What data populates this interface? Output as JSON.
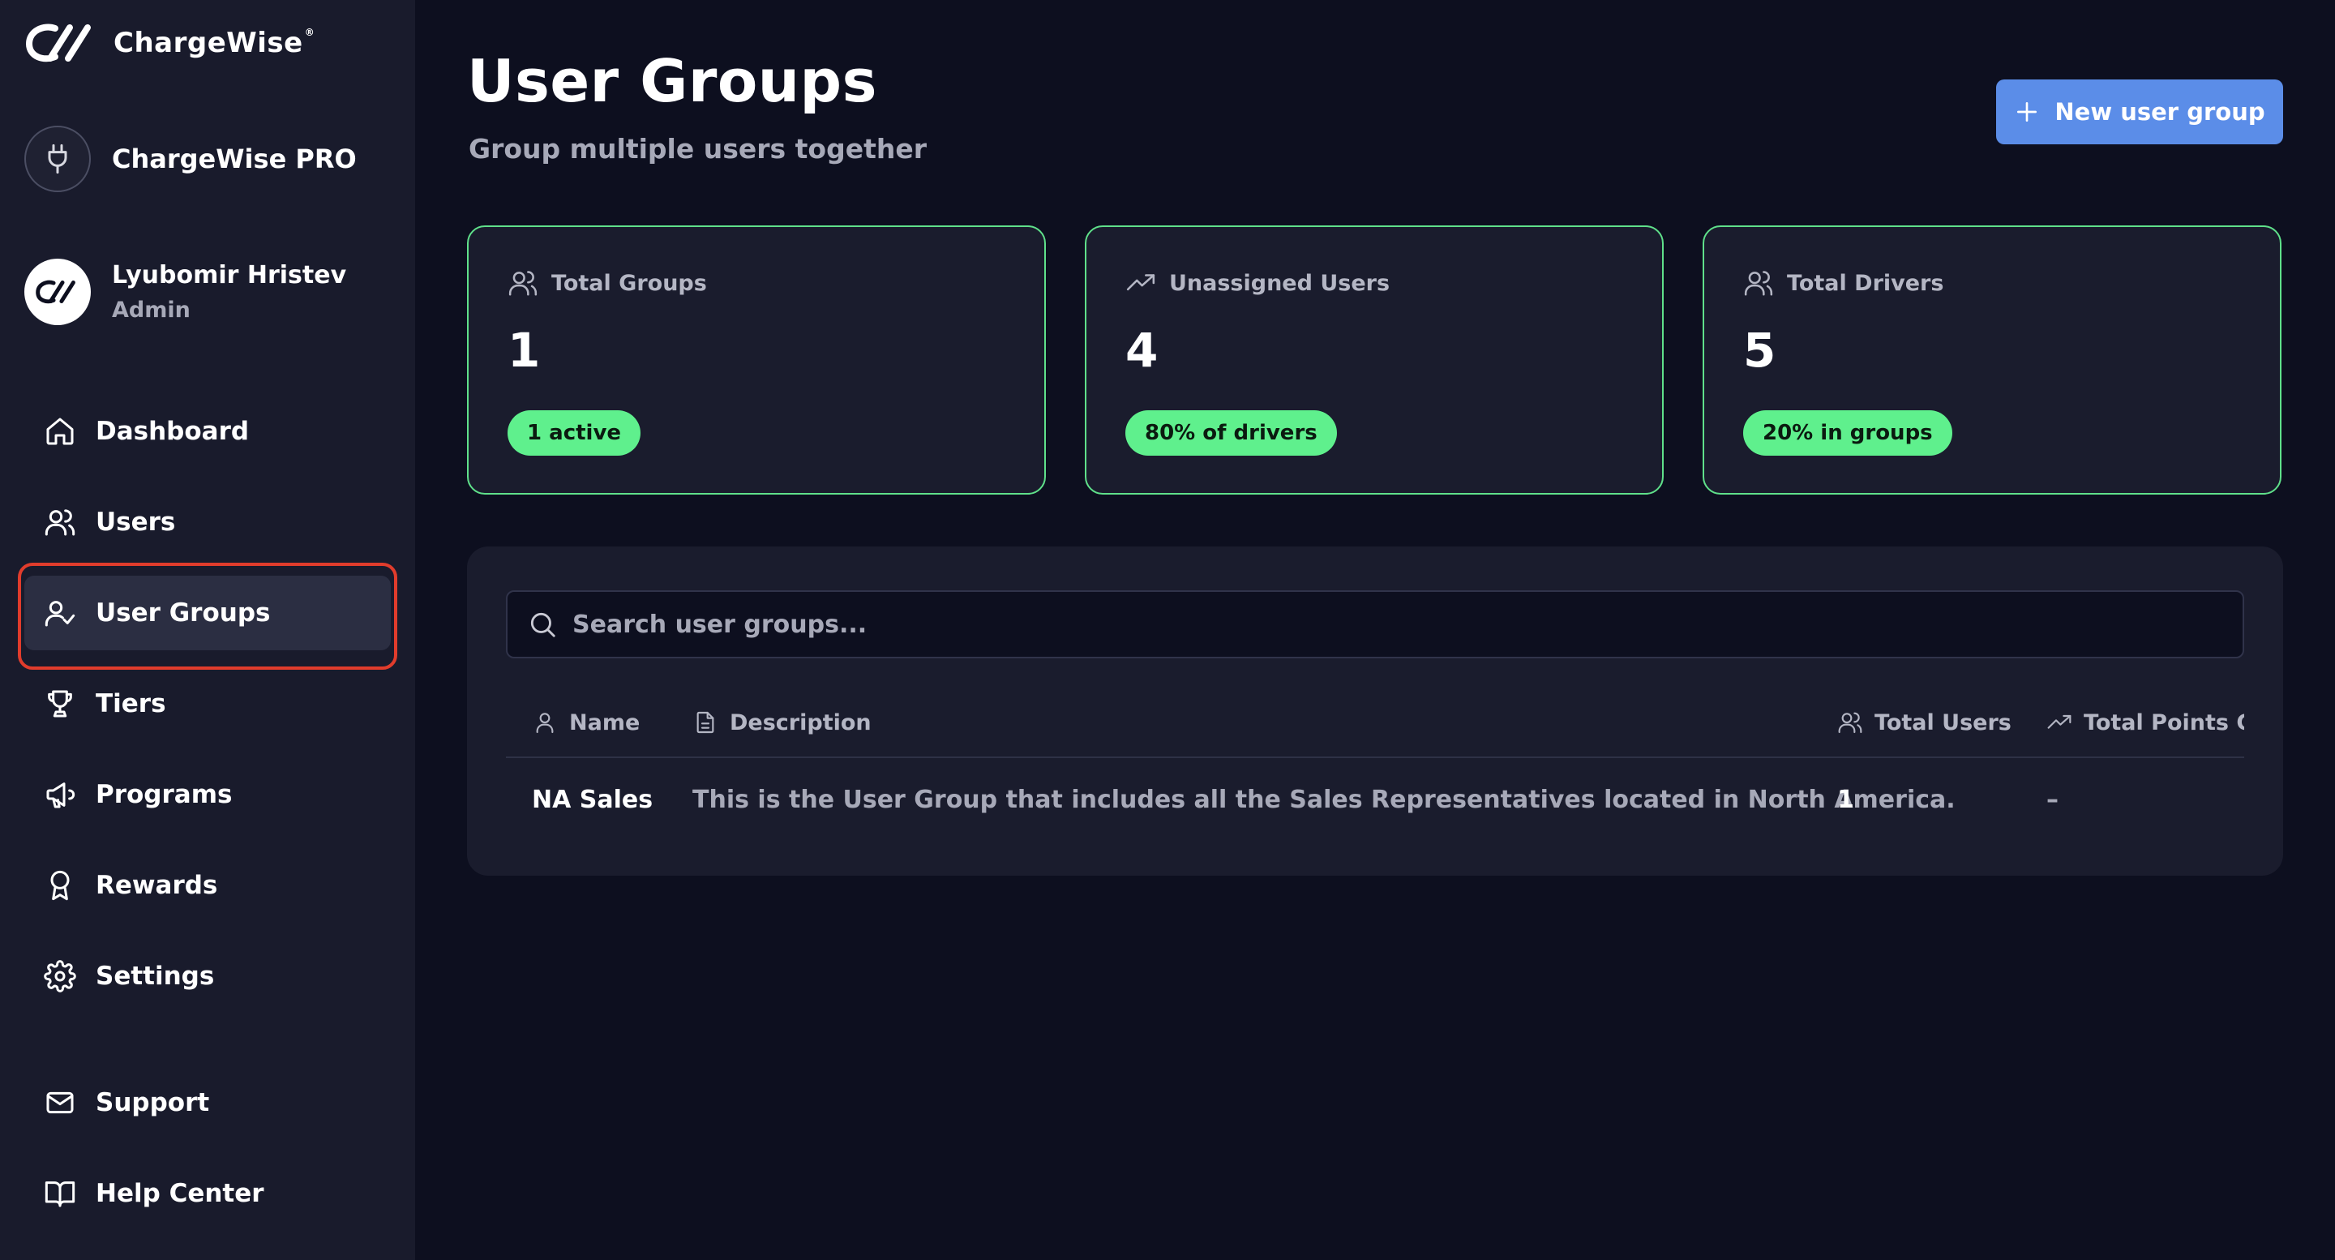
{
  "brand": {
    "name": "ChargeWise",
    "trademark": "®"
  },
  "organization": {
    "name": "ChargeWise PRO"
  },
  "user": {
    "name": "Lyubomir Hristev",
    "role": "Admin"
  },
  "sidebar": {
    "items": [
      {
        "label": "Dashboard",
        "icon": "home-icon"
      },
      {
        "label": "Users",
        "icon": "users-icon"
      },
      {
        "label": "User Groups",
        "icon": "user-check-icon",
        "active": true
      },
      {
        "label": "Tiers",
        "icon": "trophy-icon"
      },
      {
        "label": "Programs",
        "icon": "megaphone-icon"
      },
      {
        "label": "Rewards",
        "icon": "award-icon"
      },
      {
        "label": "Settings",
        "icon": "gear-icon"
      },
      {
        "label": "Support",
        "icon": "mail-icon"
      },
      {
        "label": "Help Center",
        "icon": "book-icon"
      }
    ]
  },
  "header": {
    "title": "User Groups",
    "subtitle": "Group multiple users together",
    "new_button_label": "New user group"
  },
  "stats": [
    {
      "label": "Total Groups",
      "value": "1",
      "badge": "1 active",
      "icon": "users-icon"
    },
    {
      "label": "Unassigned Users",
      "value": "4",
      "badge": "80% of drivers",
      "icon": "trending-up-icon"
    },
    {
      "label": "Total Drivers",
      "value": "5",
      "badge": "20% in groups",
      "icon": "users-icon"
    }
  ],
  "search": {
    "placeholder": "Search user groups...",
    "value": ""
  },
  "table": {
    "columns": [
      {
        "label": "Name",
        "icon": "user-icon"
      },
      {
        "label": "Description",
        "icon": "document-icon"
      },
      {
        "label": "Total Users",
        "icon": "users-icon"
      },
      {
        "label": "Total Points Ga",
        "icon": "trending-up-icon"
      }
    ],
    "rows": [
      {
        "name": "NA Sales",
        "description": "This is the User Group that includes all the Sales Representatives located in North America.",
        "total_users": "1",
        "total_points": "–"
      }
    ]
  },
  "colors": {
    "background": "#0d0f1f",
    "sidebar": "#191b2c",
    "card": "#1a1c2d",
    "accent_green": "#5ff08d",
    "primary_button": "#5b8de8",
    "highlight_outline": "#e13c2c"
  }
}
